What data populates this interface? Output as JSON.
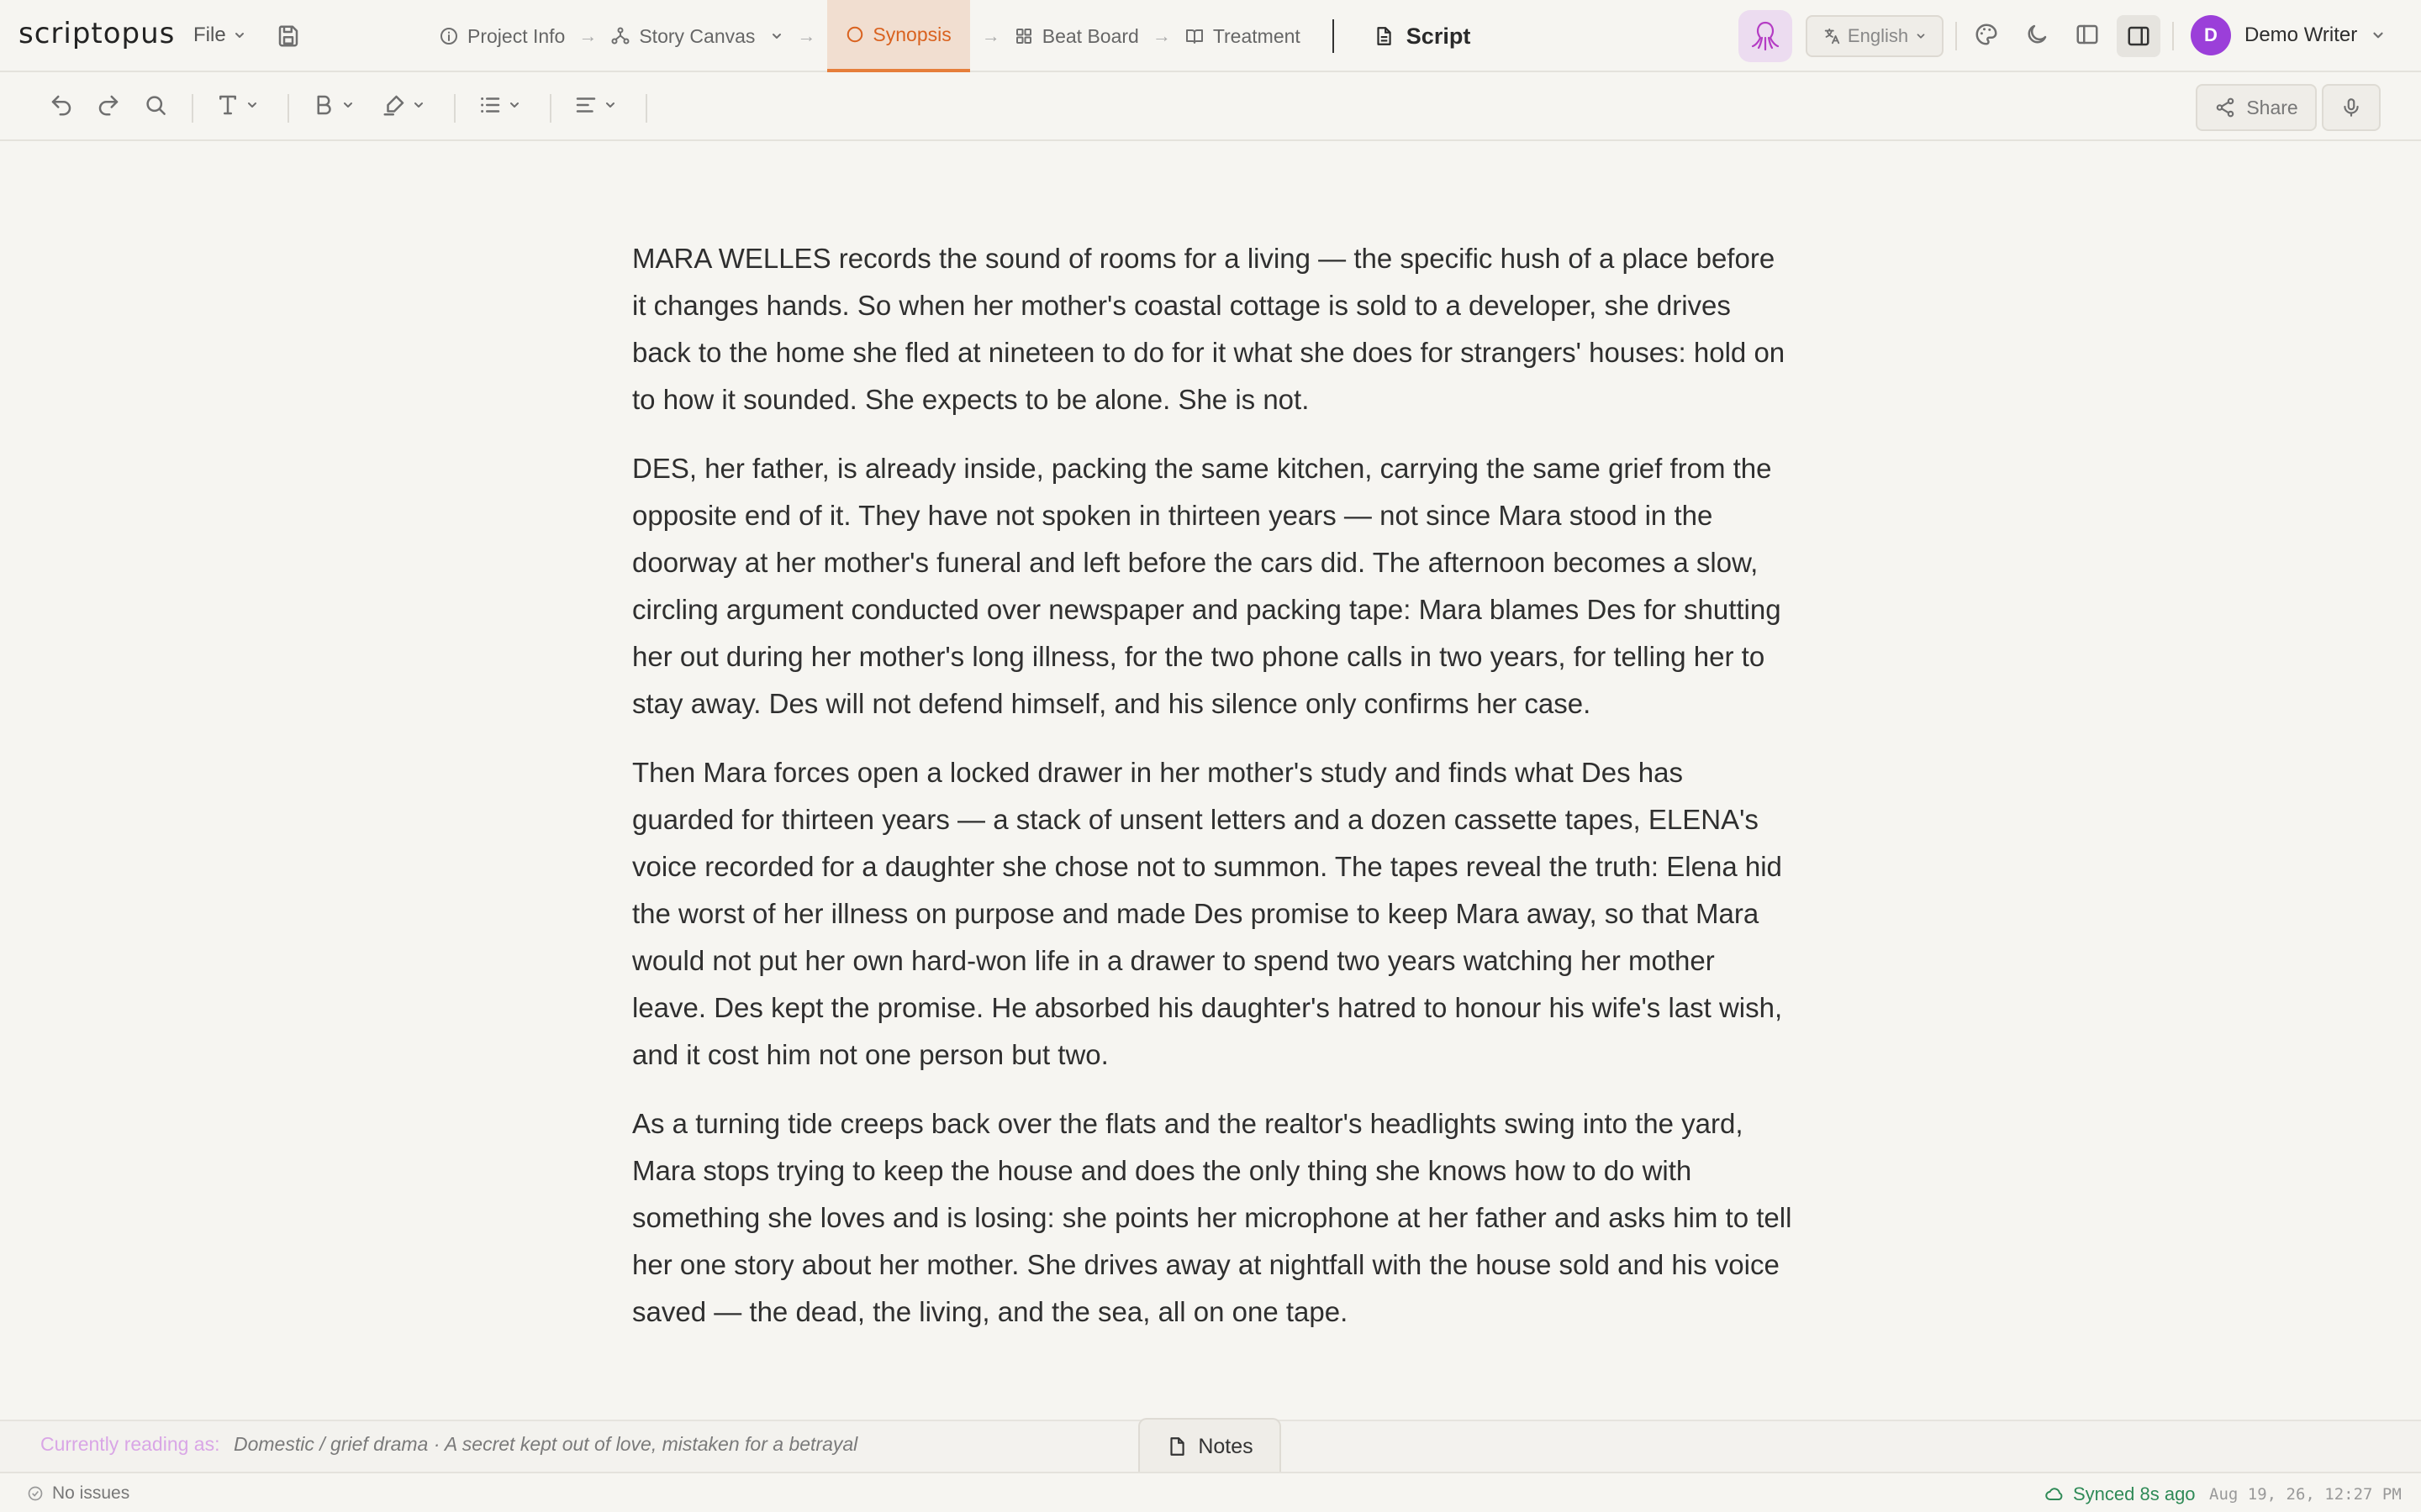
{
  "app": {
    "logo": "scriptopus"
  },
  "menu": {
    "file_label": "File"
  },
  "workflow": {
    "steps": [
      {
        "label": "Project Info",
        "icon": "info-icon"
      },
      {
        "label": "Story Canvas",
        "icon": "network-icon"
      },
      {
        "label": "Synopsis",
        "icon": "circle-icon",
        "active": true
      },
      {
        "label": "Beat Board",
        "icon": "grid-icon"
      },
      {
        "label": "Treatment",
        "icon": "book-icon"
      }
    ],
    "arrow": "→",
    "script_label": "Script"
  },
  "header": {
    "language": "English",
    "user_initial": "D",
    "user_name": "Demo Writer",
    "accent_color": "#e67e3a",
    "avatar_color": "#9b3fd9"
  },
  "toolbar": {
    "share_label": "Share"
  },
  "document": {
    "paragraphs": [
      "MARA WELLES records the sound of rooms for a living — the specific hush of a place before it changes hands. So when her mother's coastal cottage is sold to a developer, she drives back to the home she fled at nineteen to do for it what she does for strangers' houses: hold on to how it sounded. She expects to be alone. She is not.",
      "DES, her father, is already inside, packing the same kitchen, carrying the same grief from the opposite end of it. They have not spoken in thirteen years — not since Mara stood in the doorway at her mother's funeral and left before the cars did. The afternoon becomes a slow, circling argument conducted over newspaper and packing tape: Mara blames Des for shutting her out during her mother's long illness, for the two phone calls in two years, for telling her to stay away. Des will not defend himself, and his silence only confirms her case.",
      "Then Mara forces open a locked drawer in her mother's study and finds what Des has guarded for thirteen years — a stack of unsent letters and a dozen cassette tapes, ELENA's voice recorded for a daughter she chose not to summon. The tapes reveal the truth: Elena hid the worst of her illness on purpose and made Des promise to keep Mara away, so that Mara would not put her own hard-won life in a drawer to spend two years watching her mother leave. Des kept the promise. He absorbed his daughter's hatred to honour his wife's last wish, and it cost him not one person but two.",
      "As a turning tide creeps back over the flats and the realtor's headlights swing into the yard, Mara stops trying to keep the house and does the only thing she knows how to do with something she loves and is losing: she points her microphone at her father and asks him to tell her one story about her mother. She drives away at nightfall with the house sold and his voice saved — the dead, the living, and the sea, all on one tape."
    ]
  },
  "reading": {
    "label": "Currently reading as:",
    "value": "Domestic / grief drama · A secret kept out of love, mistaken for a betrayal"
  },
  "notes": {
    "label": "Notes"
  },
  "status": {
    "issues": "No issues",
    "synced": "Synced 8s ago",
    "timestamp": "Aug 19, 26, 12:27 PM"
  }
}
